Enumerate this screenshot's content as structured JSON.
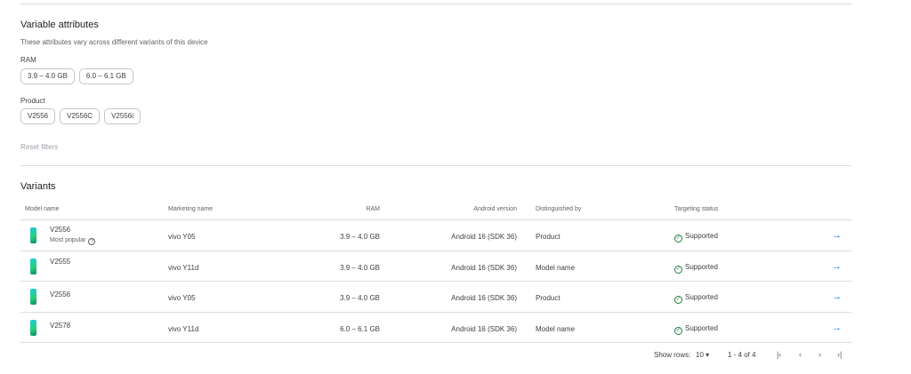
{
  "variable_attributes": {
    "title": "Variable attributes",
    "description": "These attributes vary across different variants of this device",
    "ram": {
      "label": "RAM",
      "chips": [
        "3.9 – 4.0 GB",
        "6.0 – 6.1 GB"
      ]
    },
    "product": {
      "label": "Product",
      "chips": [
        "V2556",
        "V2556C",
        "V2556i"
      ]
    },
    "reset_label": "Reset filters"
  },
  "variants": {
    "title": "Variants",
    "columns": {
      "model_name": "Model name",
      "marketing_name": "Marketing name",
      "ram": "RAM",
      "android_version": "Android version",
      "distinguished_by": "Distinguished by",
      "targeting_status": "Targeting status"
    },
    "rows": [
      {
        "model": "V2556",
        "sub": "Most popular",
        "marketing": "vivo Y05",
        "ram": "3.9 – 4.0 GB",
        "android": "Android 16 (SDK 36)",
        "distinguished": "Product",
        "status": "Supported"
      },
      {
        "model": "V2555",
        "marketing": "vivo Y11d",
        "ram": "3.9 – 4.0 GB",
        "android": "Android 16 (SDK 36)",
        "distinguished": "Model name",
        "status": "Supported"
      },
      {
        "model": "V2556",
        "marketing": "vivo Y05",
        "ram": "3.9 – 4.0 GB",
        "android": "Android 16 (SDK 36)",
        "distinguished": "Product",
        "status": "Supported"
      },
      {
        "model": "V2578",
        "marketing": "vivo Y11d",
        "ram": "6.0 – 6.1 GB",
        "android": "Android 16 (SDK 36)",
        "distinguished": "Model name",
        "status": "Supported"
      }
    ]
  },
  "pagination": {
    "show_rows_label": "Show rows:",
    "rows_value": "10",
    "range": "1 - 4 of 4",
    "first_glyph": "|‹",
    "prev_glyph": "‹",
    "next_glyph": "›",
    "last_glyph": "›|"
  },
  "icons": {
    "arrow": "→",
    "check": "✓",
    "help": "?",
    "dropdown": "▾"
  },
  "colors": {
    "link": "#1a73e8",
    "success": "#188038",
    "border": "#dadce0"
  }
}
